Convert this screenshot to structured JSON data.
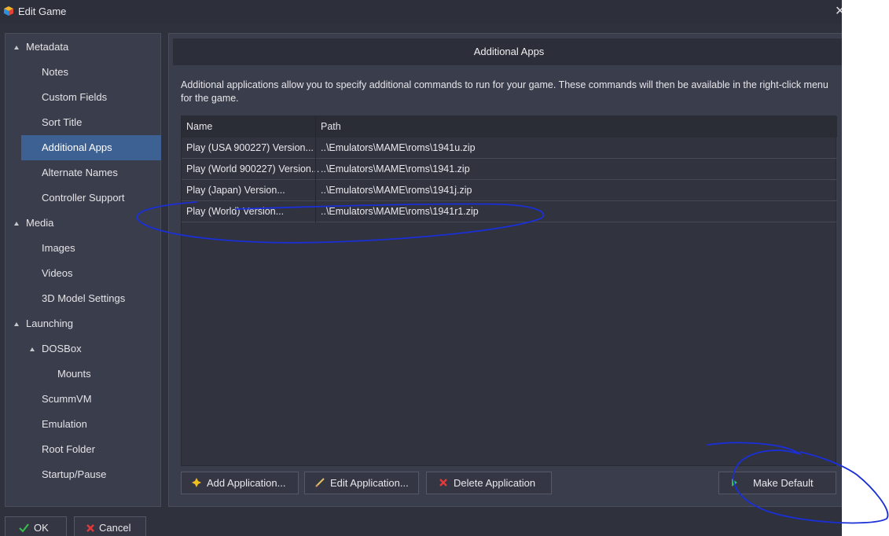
{
  "window": {
    "title": "Edit Game",
    "close_glyph": "✕"
  },
  "sidebar": {
    "items": [
      {
        "label": "Metadata",
        "section": true
      },
      {
        "label": "Notes"
      },
      {
        "label": "Custom Fields"
      },
      {
        "label": "Sort Title"
      },
      {
        "label": "Additional Apps",
        "selected": true
      },
      {
        "label": "Alternate Names"
      },
      {
        "label": "Controller Support"
      },
      {
        "label": "Media",
        "section": true
      },
      {
        "label": "Images"
      },
      {
        "label": "Videos"
      },
      {
        "label": "3D Model Settings"
      },
      {
        "label": "Launching",
        "section": true
      },
      {
        "label": "DOSBox"
      },
      {
        "label": "Mounts"
      },
      {
        "label": "ScummVM"
      },
      {
        "label": "Emulation"
      },
      {
        "label": "Root Folder"
      },
      {
        "label": "Startup/Pause"
      }
    ]
  },
  "main": {
    "header": "Additional Apps",
    "description": "Additional applications allow you to specify additional commands to run for your game.  These commands will then be available in the right-click menu for the game.",
    "table": {
      "columns": [
        "Name",
        "Path"
      ],
      "rows": [
        {
          "name": "Play (USA 900227) Version...",
          "path": "..\\Emulators\\MAME\\roms\\1941u.zip"
        },
        {
          "name": "Play (World 900227) Version...",
          "path": "..\\Emulators\\MAME\\roms\\1941.zip"
        },
        {
          "name": "Play (Japan) Version...",
          "path": "..\\Emulators\\MAME\\roms\\1941j.zip"
        },
        {
          "name": "Play (World) Version...",
          "path": "..\\Emulators\\MAME\\roms\\1941r1.zip"
        }
      ]
    },
    "buttons": {
      "add": "Add Application...",
      "edit": "Edit Application...",
      "delete": "Delete Application",
      "make_default": "Make Default"
    }
  },
  "footer": {
    "ok": "OK",
    "cancel": "Cancel"
  },
  "colors": {
    "background": "#2f313d",
    "selected": "#3e6193",
    "annotation": "#1a2fd6",
    "ok_icon": "#36c24a",
    "cancel_icon": "#e23a3a",
    "add_icon": "#f0c020",
    "edit_icon": "#e0c060",
    "play_icon": "#36c24a"
  }
}
